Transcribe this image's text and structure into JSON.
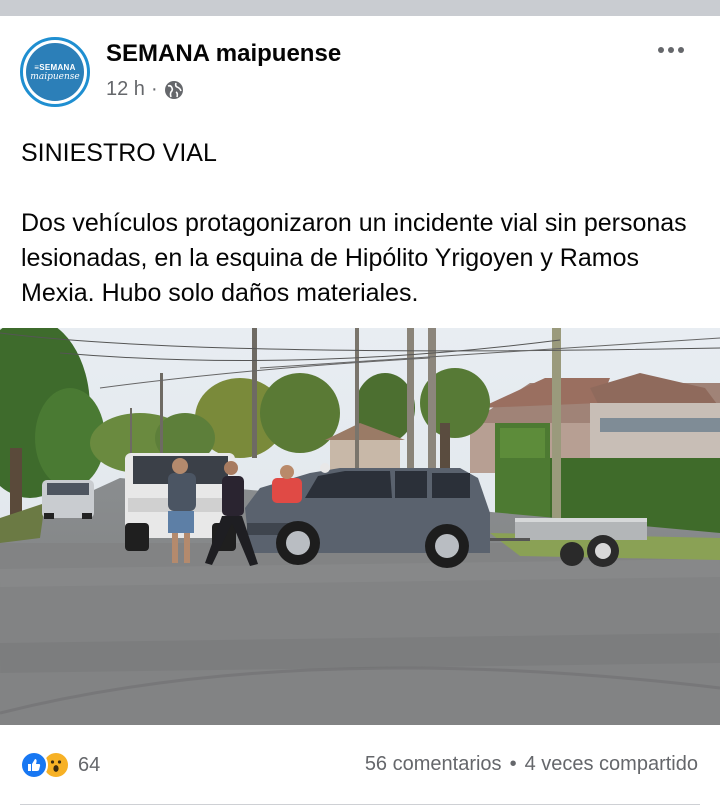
{
  "post": {
    "page_name": "SEMANA maipuense",
    "avatar_text_top": "≡SEMANA",
    "avatar_text_bottom": "maipuense",
    "time": "12 h",
    "separator": "·",
    "title": "SINIESTRO VIAL",
    "body": "Dos vehículos protagonizaron un incidente vial sin personas lesionadas, en la esquina de Hipólito Yrigoyen y Ramos Mexia. Hubo solo daños materiales."
  },
  "footer": {
    "reaction_count": "64",
    "comments": "56 comentarios",
    "dot": "•",
    "shares": "4 veces compartido"
  },
  "icons": {
    "audience": "globe-icon",
    "menu": "more-options-icon",
    "reaction1": "like-icon",
    "reaction2": "wow-icon"
  },
  "colors": {
    "brand": "#1877f2",
    "avatar_ring": "#1f8fd1",
    "secondary_text": "#65676b"
  }
}
